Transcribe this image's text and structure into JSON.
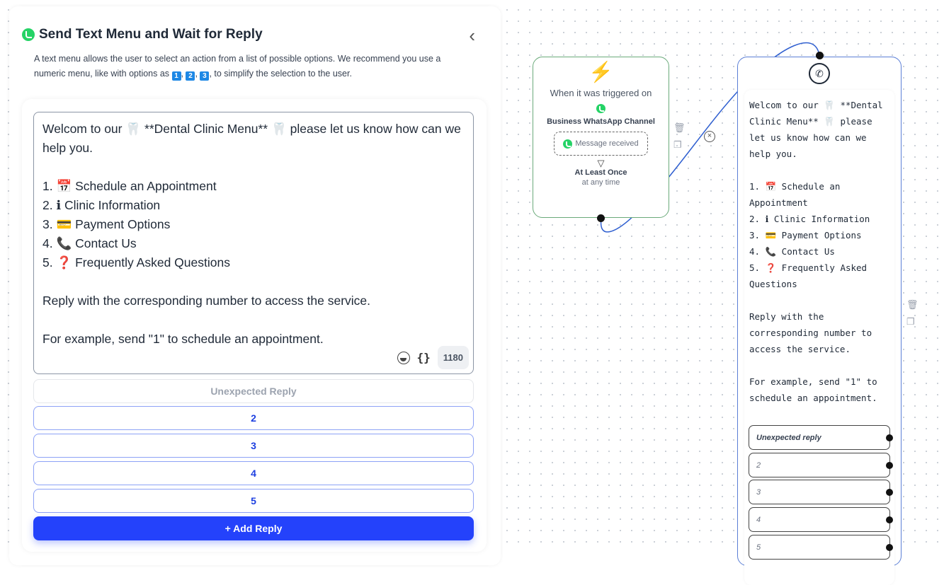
{
  "panel": {
    "title": "Send Text Menu and Wait for Reply",
    "back_icon": "chevron-left-icon",
    "description_a": "A text menu allows the user to select an action from a list of possible options. We recommend you use a numeric menu, like with options as ",
    "description_keys": [
      "1",
      "2",
      "3"
    ],
    "description_b": ", to simplify the selection to the user.",
    "message": "Welcom to our 🦷 **Dental Clinic Menu** 🦷 please let us know how can we help you.\n\n1. 📅 Schedule an Appointment\n2. ℹ Clinic Information\n3. 💳 Payment Options\n4. 📞 Contact Us\n5. ❓ Frequently Asked Questions\n\nReply with the corresponding number to access the service.\n\nFor example, send \"1\" to schedule an appointment.",
    "char_count": "1180",
    "variables_label": "{}",
    "unexpected_label": "Unexpected Reply",
    "replies": [
      "2",
      "3",
      "4",
      "5"
    ],
    "add_reply_label": "+ Add Reply"
  },
  "trigger_node": {
    "icon": "⚡",
    "heading": "When it was triggered on",
    "channel": "Business WhatsApp Channel",
    "event": "Message received",
    "filter_icon": "▽",
    "frequency": "At Least Once",
    "timing": "at any time"
  },
  "menu_node": {
    "message": "Welcom to our 🦷 **Dental Clinic Menu** 🦷 please let us know how can we help you.\n\n1. 📅 Schedule an Appointment\n2. ℹ Clinic Information\n3. 💳 Payment Options\n4. 📞 Contact Us\n5. ❓ Frequently Asked Questions\n\nReply with the corresponding number to access the service.\n\nFor example, send \"1\" to schedule an appointment.",
    "outputs": [
      "Unexpected reply",
      "2",
      "3",
      "4",
      "5"
    ]
  },
  "colors": {
    "accent": "#2442fb",
    "trigger_border": "#6aaa7a",
    "node_border": "#5b7fd6",
    "whatsapp": "#25d366"
  }
}
